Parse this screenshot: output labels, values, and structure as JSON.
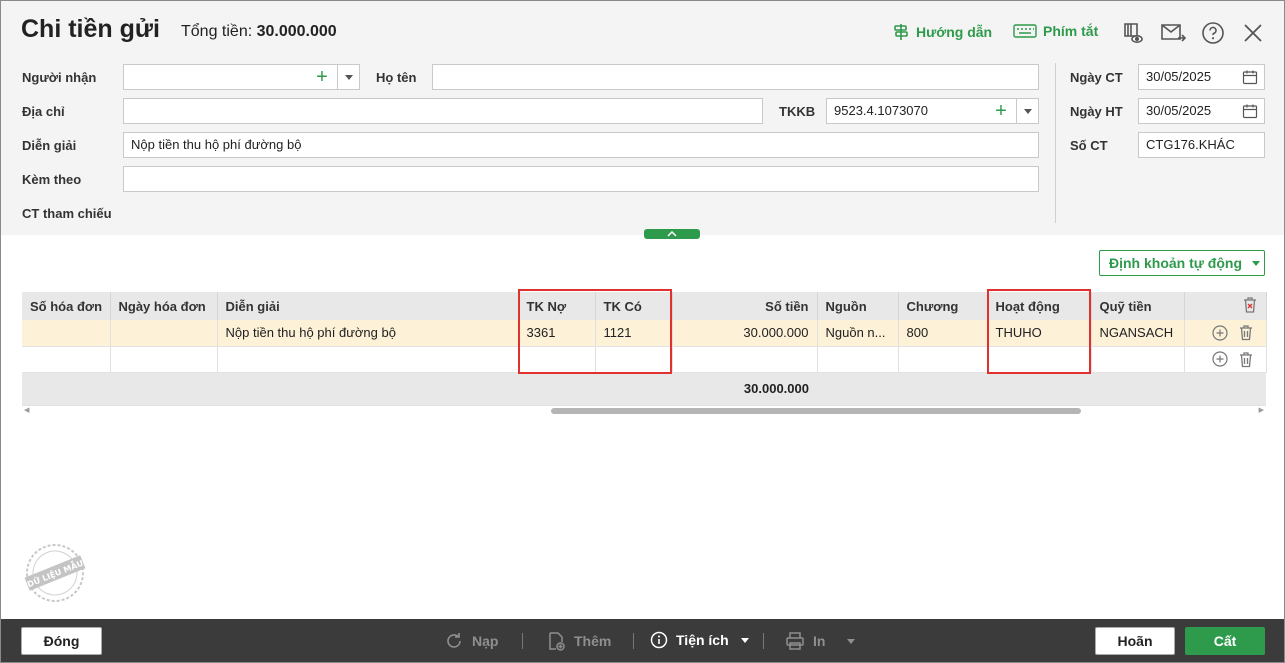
{
  "header": {
    "title": "Chi tiền gửi",
    "total_label": "Tổng tiền:",
    "total_value": "30.000.000",
    "guide_label": "Hướng dẫn",
    "shortcut_label": "Phím tắt"
  },
  "form": {
    "recipient_label": "Người nhận",
    "recipient_value": "",
    "fullname_label": "Họ tên",
    "fullname_value": "",
    "address_label": "Địa chỉ",
    "address_value": "",
    "tkkb_label": "TKKB",
    "tkkb_value": "9523.4.1073070",
    "description_label": "Diễn giải",
    "description_value": "Nộp tiền thu hộ phí đường bộ",
    "attachment_label": "Kèm theo",
    "attachment_value": "",
    "reference_label": "CT tham chiếu",
    "doc_date_label": "Ngày CT",
    "doc_date_value": "30/05/2025",
    "post_date_label": "Ngày HT",
    "post_date_value": "30/05/2025",
    "doc_no_label": "Số CT",
    "doc_no_value": "CTG176.KHÁC"
  },
  "auto_entry_label": "Định khoản tự động",
  "grid": {
    "columns": [
      "Số hóa đơn",
      "Ngày hóa đơn",
      "Diễn giải",
      "TK Nợ",
      "TK Có",
      "Số tiền",
      "Nguồn",
      "Chương",
      "Hoạt động",
      "Quỹ tiền"
    ],
    "rows": [
      [
        "",
        "",
        "Nộp tiền thu hộ phí đường bộ",
        "3361",
        "1121",
        "30.000.000",
        "Nguồn n...",
        "800",
        "THUHO",
        "NGANSACH"
      ],
      [
        "",
        "",
        "",
        "",
        "",
        "",
        "",
        "",
        "",
        ""
      ]
    ],
    "total_amount": "30.000.000"
  },
  "watermark_text": "DỮ LIỆU MẪU",
  "footer": {
    "close_label": "Đóng",
    "reload_label": "Nạp",
    "add_label": "Thêm",
    "utilities_label": "Tiện ích",
    "print_label": "In",
    "cancel_label": "Hoãn",
    "save_label": "Cất"
  },
  "colors": {
    "accent": "#2e9a4b",
    "highlight": "#e03131",
    "selected_row": "#fdf2d8",
    "footer_bg": "#3b3b3b"
  }
}
